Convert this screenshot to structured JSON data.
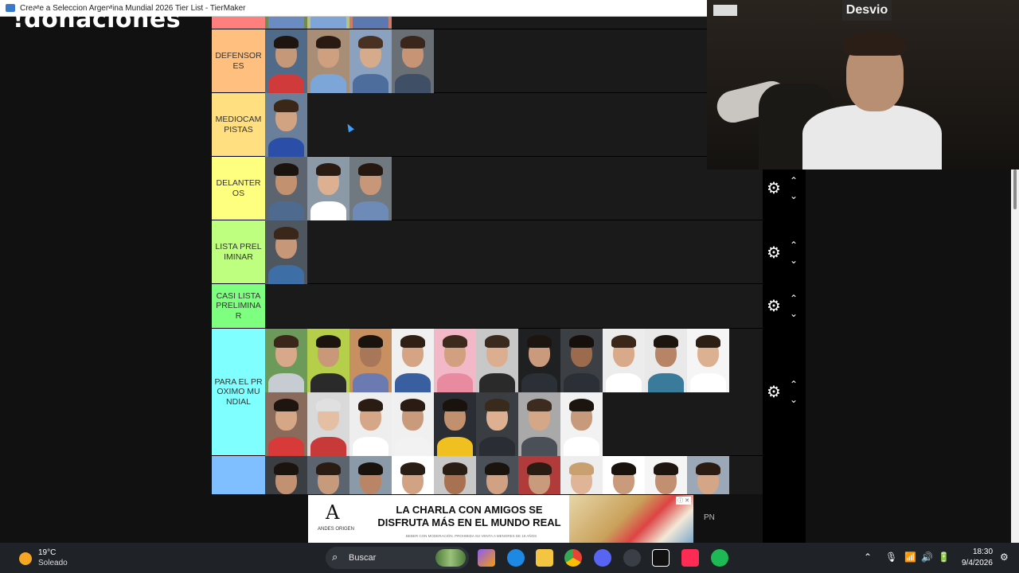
{
  "window": {
    "title": "Create a Seleccion Argentina Mundial 2026 Tier List - TierMaker"
  },
  "overlay": {
    "text": "!donaciones"
  },
  "tiers": [
    {
      "id": "top",
      "label": "",
      "color": "#ff7f7f",
      "top": 0,
      "height": 16,
      "items": [
        {
          "skin": "#c89b7b",
          "hair": "#2b1d14",
          "shirt": "#6b8cc2",
          "bg": "#6f8b52"
        },
        {
          "skin": "#d2a485",
          "hair": "#3a2618",
          "shirt": "#7fa4d8",
          "bg": "#b9c27f"
        },
        {
          "skin": "#c08f72",
          "hair": "#1f1610",
          "shirt": "#5b79b0",
          "bg": "#d07a6a"
        }
      ]
    },
    {
      "id": "defensores",
      "label": "DEFENSORES",
      "color": "#ffbf7f",
      "items": [
        {
          "skin": "#c6987a",
          "hair": "#1e1510",
          "shirt": "#d03a3a",
          "bg": "#506b8a"
        },
        {
          "skin": "#cfa080",
          "hair": "#2a1b12",
          "shirt": "#7da6d8",
          "bg": "#a88e76"
        },
        {
          "skin": "#d6ab8c",
          "hair": "#4a3222",
          "shirt": "#4d6e9c",
          "bg": "#8aa2c0"
        },
        {
          "skin": "#c89476",
          "hair": "#3a261a",
          "shirt": "#3f4f66",
          "bg": "#6a6f76"
        }
      ]
    },
    {
      "id": "mediocampistas",
      "label": "MEDIOCAMPISTAS",
      "color": "#ffdf7f",
      "items": [
        {
          "skin": "#d2a383",
          "hair": "#3b2718",
          "shirt": "#2b4ea8",
          "bg": "#6a7f99"
        }
      ]
    },
    {
      "id": "delanteros",
      "label": "DELANTEROS",
      "color": "#ffff7f",
      "items": [
        {
          "skin": "#c29170",
          "hair": "#1b130d",
          "shirt": "#4f6a8f",
          "bg": "#5c6470"
        },
        {
          "skin": "#dcb091",
          "hair": "#2a1c13",
          "shirt": "#ffffff",
          "bg": "#8c9aa8"
        },
        {
          "skin": "#c89678",
          "hair": "#241810",
          "shirt": "#6e8bb8",
          "bg": "#707880"
        }
      ]
    },
    {
      "id": "preliminar",
      "label": "LISTA PRELIMINAR",
      "color": "#bfff7f",
      "items": [
        {
          "skin": "#c7977a",
          "hair": "#3a271a",
          "shirt": "#3d6ea6",
          "bg": "#4e5660"
        }
      ]
    },
    {
      "id": "casi",
      "label": "CASI LISTAPRELIMINAR",
      "color": "#7fff7f",
      "items": []
    },
    {
      "id": "proximo",
      "label": "PARA EL PROXIMO MUNDIAL",
      "color": "#7fffff",
      "items": [
        {
          "skin": "#d7a98a",
          "hair": "#3a2719",
          "shirt": "#c7ccd2",
          "bg": "#6b9a5a"
        },
        {
          "skin": "#c99878",
          "hair": "#1d140e",
          "shirt": "#2a2a2a",
          "bg": "#b5cf4a"
        },
        {
          "skin": "#a87658",
          "hair": "#1a120c",
          "shirt": "#6b7ab0",
          "bg": "#c89060"
        },
        {
          "skin": "#d5a484",
          "hair": "#2f1f14",
          "shirt": "#3a5fa0",
          "bg": "#f0f0f0"
        },
        {
          "skin": "#d1a080",
          "hair": "#3c2a1c",
          "shirt": "#e88aa0",
          "bg": "#f3b8c8"
        },
        {
          "skin": "#dcae90",
          "hair": "#3b2a1e",
          "shirt": "#2a2a2a",
          "bg": "#c8c8c8"
        },
        {
          "skin": "#c99a7c",
          "hair": "#1c140e",
          "shirt": "#2b2f36",
          "bg": "#1f2022"
        },
        {
          "skin": "#9c6a4c",
          "hair": "#15100c",
          "shirt": "#2b2f36",
          "bg": "#3c3f44"
        },
        {
          "skin": "#d8aa8a",
          "hair": "#3a2719",
          "shirt": "#ffffff",
          "bg": "#ececec"
        },
        {
          "skin": "#b78566",
          "hair": "#1b140f",
          "shirt": "#3a7a9a",
          "bg": "#e9e9e9"
        },
        {
          "skin": "#dcb192",
          "hair": "#2e1f15",
          "shirt": "#ffffff",
          "bg": "#f5f5f5"
        },
        {
          "skin": "#d6a786",
          "hair": "#1e1510",
          "shirt": "#d83a3a",
          "bg": "#8a6a5a"
        },
        {
          "skin": "#e5bfa3",
          "hair": "#e0e0e0",
          "shirt": "#c83a3a",
          "bg": "#d9d9d9"
        },
        {
          "skin": "#d5a687",
          "hair": "#2a1c13",
          "shirt": "#ffffff",
          "bg": "#eeeeee"
        },
        {
          "skin": "#c99a7b",
          "hair": "#2a1c13",
          "shirt": "#f2f2f2",
          "bg": "#f0f0f0"
        },
        {
          "skin": "#c1906f",
          "hair": "#1a130d",
          "shirt": "#f0c020",
          "bg": "#2a2d33"
        },
        {
          "skin": "#dcb090",
          "hair": "#3a2a1c",
          "shirt": "#2a2d33",
          "bg": "#3a3d42"
        },
        {
          "skin": "#d5a789",
          "hair": "#3c2b1e",
          "shirt": "#4a4f58",
          "bg": "#a9a9a9"
        },
        {
          "skin": "#c89a7c",
          "hair": "#1c140e",
          "shirt": "#ffffff",
          "bg": "#f2f2f2"
        }
      ]
    },
    {
      "id": "next",
      "label": "",
      "color": "#7fbfff",
      "items": [
        {
          "skin": "#c29172",
          "hair": "#1b140e",
          "shirt": "#2a2d33",
          "bg": "#3a3d42"
        },
        {
          "skin": "#c89a7c",
          "hair": "#2a1c13",
          "shirt": "#4a4f58",
          "bg": "#5c6470"
        },
        {
          "skin": "#b98566",
          "hair": "#1a130d",
          "shirt": "#c83a3a",
          "bg": "#8a9aa8"
        },
        {
          "skin": "#d1a384",
          "hair": "#2a1d14",
          "shirt": "#3a7a9a",
          "bg": "#ffffff"
        },
        {
          "skin": "#a87252",
          "hair": "#2a1d14",
          "shirt": "#2a2d33",
          "bg": "#c8c8c8"
        },
        {
          "skin": "#d0a182",
          "hair": "#1b140e",
          "shirt": "#3a3d42",
          "bg": "#4a4f58"
        },
        {
          "skin": "#c99a7b",
          "hair": "#2a1c13",
          "shirt": "#2a2d33",
          "bg": "#b13a3a"
        },
        {
          "skin": "#e0b597",
          "hair": "#c9a070",
          "shirt": "#6b9a5a",
          "bg": "#eeeeee"
        },
        {
          "skin": "#c99a7c",
          "hair": "#1a130d",
          "shirt": "#f2f2f2",
          "bg": "#ffffff"
        },
        {
          "skin": "#c28f70",
          "hair": "#1e1510",
          "shirt": "#ffffff",
          "bg": "#f5f5f5"
        },
        {
          "skin": "#d4a586",
          "hair": "#2a1c13",
          "shirt": "#3a6a9a",
          "bg": "#9aa8b8"
        }
      ]
    }
  ],
  "controls": {
    "gear": "⚙",
    "up": "⌃",
    "down": "⌄"
  },
  "webcam": {
    "sign": "Desvio"
  },
  "ad": {
    "headline": "LA CHARLA CON AMIGOS SE DISFRUTA MÁS EN EL MUNDO REAL",
    "brand": "ANDES ORIGEN",
    "fine_print": "BEBER CON MODERACIÓN. PROHIBIDA SU VENTA A MENORES DE 18 AÑOS",
    "adchoices": "ⓘ ✕"
  },
  "side_label": "PN",
  "taskbar": {
    "weather_temp": "19°C",
    "weather_condition": "Soleado",
    "search_placeholder": "Buscar",
    "time": "18:30",
    "date": "9/4/2026"
  }
}
